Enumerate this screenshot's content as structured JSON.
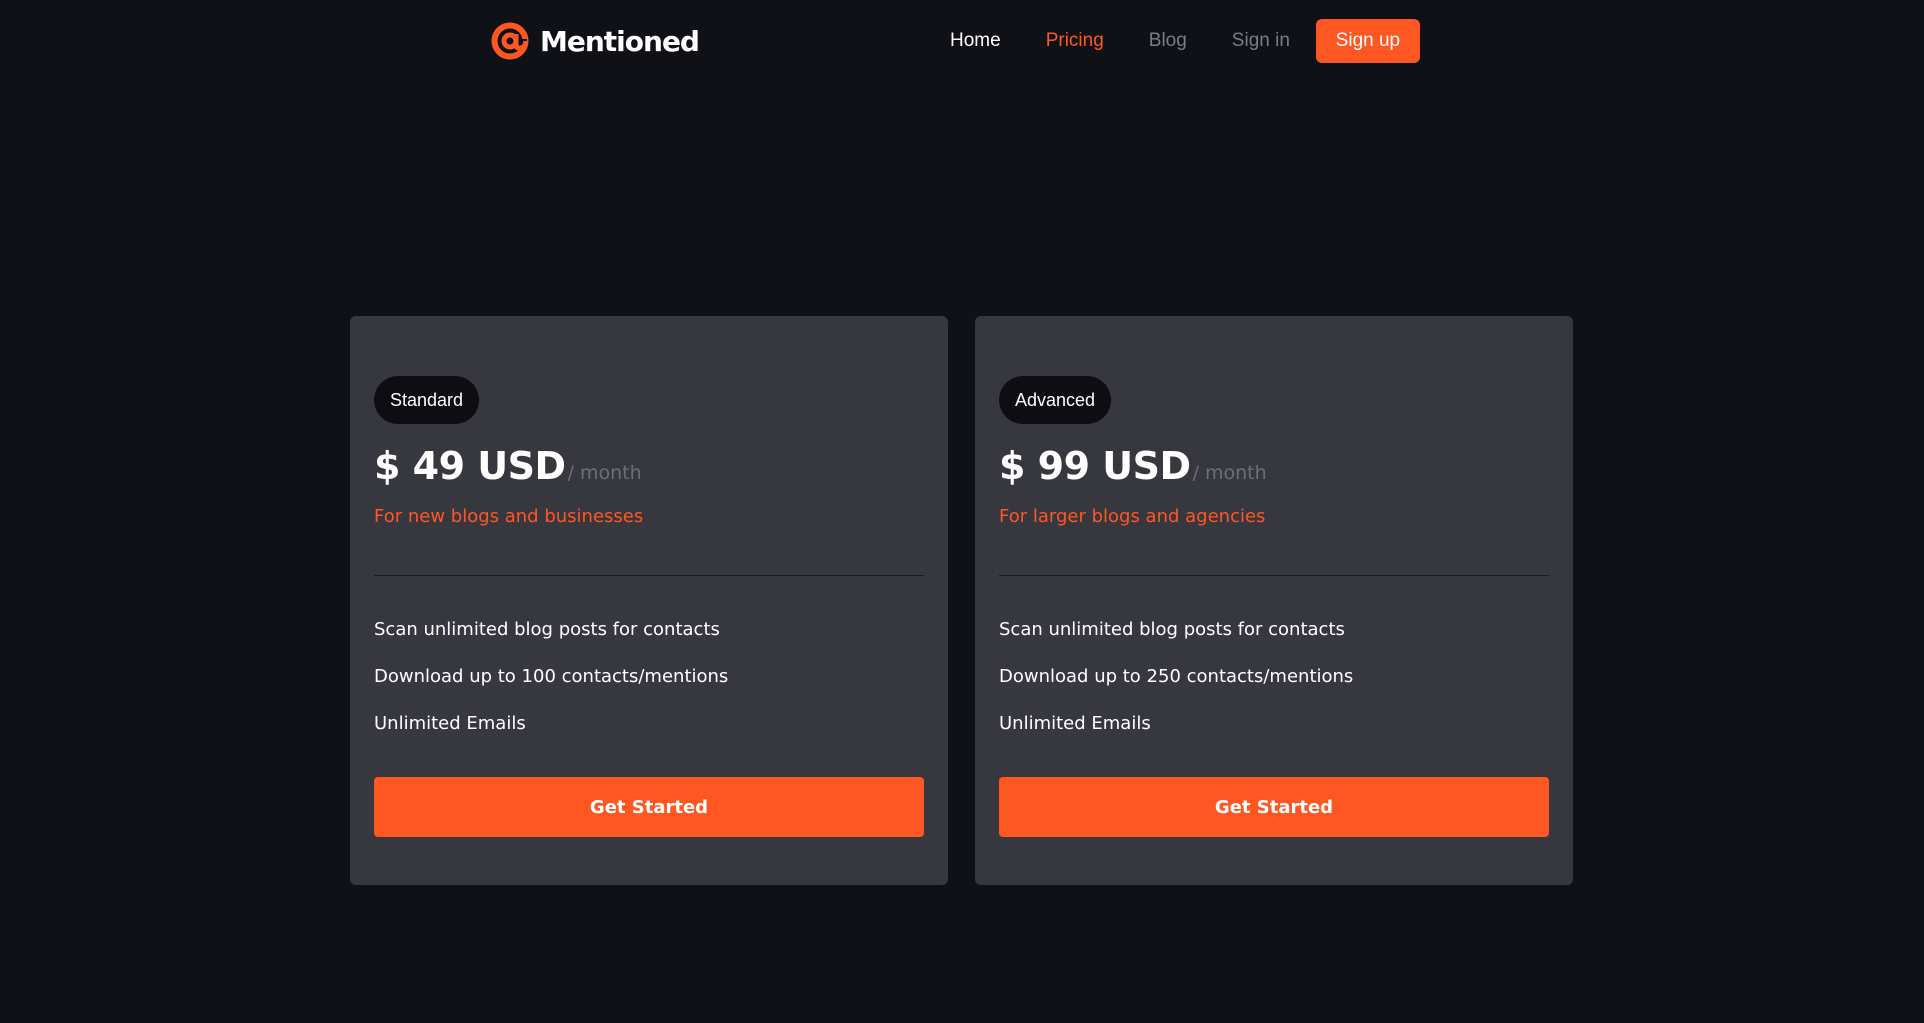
{
  "brand": {
    "name": "Mentioned",
    "accent_color": "#ff5722",
    "icon": "at-sign-icon"
  },
  "nav": {
    "home": "Home",
    "pricing": "Pricing",
    "blog": "Blog",
    "signin": "Sign in",
    "signup": "Sign up"
  },
  "plans": [
    {
      "badge": "Standard",
      "price": "$ 49 USD",
      "period": "/ month",
      "tagline": "For new blogs and businesses",
      "features": [
        "Scan unlimited blog posts for contacts",
        "Download up to 100 contacts/mentions",
        "Unlimited Emails"
      ],
      "cta": "Get Started"
    },
    {
      "badge": "Advanced",
      "price": "$ 99 USD",
      "period": "/ month",
      "tagline": "For larger blogs and agencies",
      "features": [
        "Scan unlimited blog posts for contacts",
        "Download up to 250 contacts/mentions",
        "Unlimited Emails"
      ],
      "cta": "Get Started"
    }
  ]
}
